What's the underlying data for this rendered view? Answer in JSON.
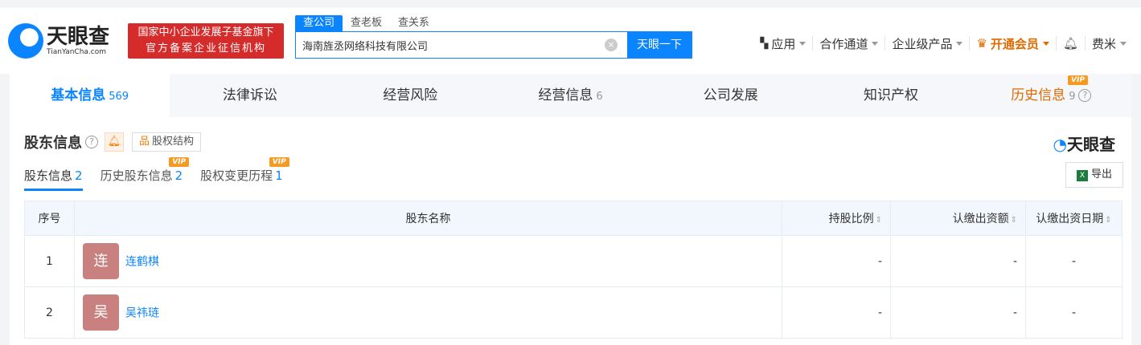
{
  "header": {
    "logo_cn": "天眼查",
    "logo_en": "TianYanCha.com",
    "badge_line1": "国家中小企业发展子基金旗下",
    "badge_line2": "官方备案企业征信机构",
    "search_tabs": [
      "查公司",
      "查老板",
      "查关系"
    ],
    "search_value": "海南旌丞网络科技有限公司",
    "search_button": "天眼一下",
    "nav": [
      "应用",
      "合作通道",
      "企业级产品",
      "开通会员",
      "费米"
    ]
  },
  "tabs": [
    {
      "label": "基本信息",
      "count": "569"
    },
    {
      "label": "法律诉讼",
      "count": ""
    },
    {
      "label": "经营风险",
      "count": ""
    },
    {
      "label": "经营信息",
      "count": "6"
    },
    {
      "label": "公司发展",
      "count": ""
    },
    {
      "label": "知识产权",
      "count": ""
    },
    {
      "label": "历史信息",
      "count": "9"
    }
  ],
  "vip": "VIP",
  "section": {
    "title": "股东信息",
    "equity_button": "股权结构",
    "brand": "天眼查",
    "export": "导出",
    "subtabs": [
      {
        "label": "股东信息",
        "count": "2"
      },
      {
        "label": "历史股东信息",
        "count": "2"
      },
      {
        "label": "股权变更历程",
        "count": "1"
      }
    ]
  },
  "table": {
    "headers": [
      "序号",
      "股东名称",
      "持股比例",
      "认缴出资额",
      "认缴出资日期"
    ],
    "rows": [
      {
        "index": "1",
        "avatar": "连",
        "name": "连鹤棋",
        "ratio": "-",
        "amount": "-",
        "date": "-"
      },
      {
        "index": "2",
        "avatar": "吴",
        "name": "吴祎琏",
        "ratio": "-",
        "amount": "-",
        "date": "-"
      }
    ]
  }
}
